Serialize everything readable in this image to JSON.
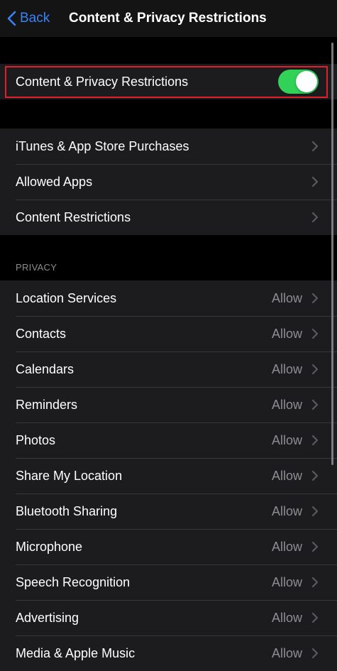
{
  "navbar": {
    "back_label": "Back",
    "title": "Content & Privacy Restrictions"
  },
  "master_toggle": {
    "label": "Content & Privacy Restrictions",
    "state": "on",
    "color": "#32d158"
  },
  "store_group": {
    "items": [
      {
        "label": "iTunes & App Store Purchases"
      },
      {
        "label": "Allowed Apps"
      },
      {
        "label": "Content Restrictions"
      }
    ]
  },
  "privacy": {
    "header": "PRIVACY",
    "items": [
      {
        "label": "Location Services",
        "value": "Allow"
      },
      {
        "label": "Contacts",
        "value": "Allow"
      },
      {
        "label": "Calendars",
        "value": "Allow"
      },
      {
        "label": "Reminders",
        "value": "Allow"
      },
      {
        "label": "Photos",
        "value": "Allow"
      },
      {
        "label": "Share My Location",
        "value": "Allow"
      },
      {
        "label": "Bluetooth Sharing",
        "value": "Allow"
      },
      {
        "label": "Microphone",
        "value": "Allow"
      },
      {
        "label": "Speech Recognition",
        "value": "Allow"
      },
      {
        "label": "Advertising",
        "value": "Allow"
      },
      {
        "label": "Media & Apple Music",
        "value": "Allow"
      }
    ]
  },
  "colors": {
    "accent": "#3a82f7",
    "highlight": "#e0202b"
  },
  "icons": {
    "back": "chevron-left-icon",
    "disclosure": "chevron-right-icon"
  }
}
